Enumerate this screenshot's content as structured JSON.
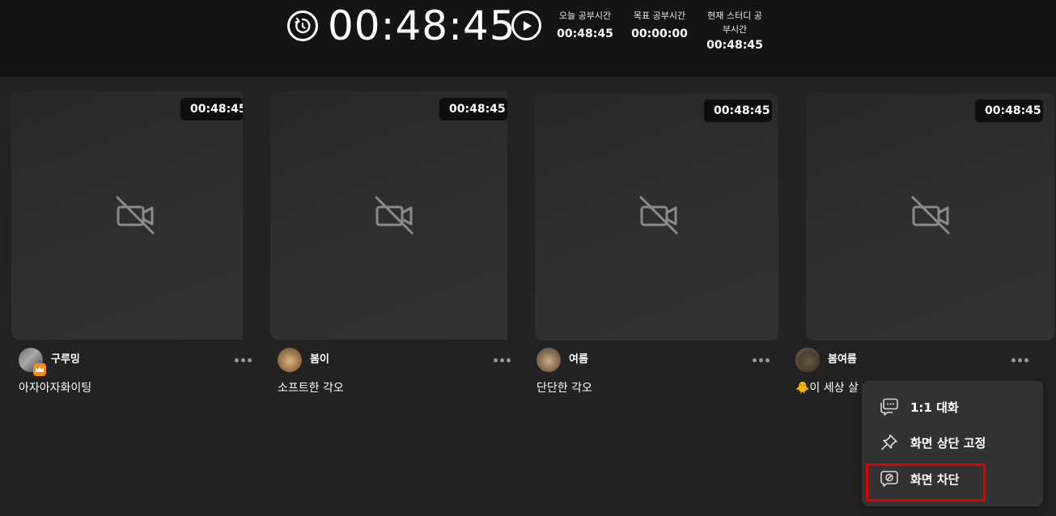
{
  "timer": {
    "elapsed": "00:48:45",
    "reset_icon": "reset-icon",
    "play_icon": "play-icon"
  },
  "stats": {
    "today_label": "오늘 공부시간",
    "today_value": "00:48:45",
    "goal_label": "목표 공부시간",
    "goal_value": "00:00:00",
    "current_label_line1": "현재 스터디 공",
    "current_label_line2": "부시간",
    "current_value": "00:48:45"
  },
  "participants": [
    {
      "name": "구루밍",
      "time": "00:48:45",
      "status": "아자아자화이팅",
      "is_host": true
    },
    {
      "name": "봄이",
      "time": "00:48:45",
      "status": "소프트한 각오",
      "is_host": false
    },
    {
      "name": "여름",
      "time": "00:48:45",
      "status": "단단한 각오",
      "is_host": false
    },
    {
      "name": "봄여름",
      "time": "00:48:45",
      "status": "🐥이 세상 살",
      "is_host": false
    }
  ],
  "context_menu": {
    "items": [
      {
        "label": "1:1 대화",
        "icon": "chat-icon"
      },
      {
        "label": "화면 상단 고정",
        "icon": "pin-icon"
      },
      {
        "label": "화면 차단",
        "icon": "block-screen-icon"
      }
    ],
    "highlight_color": "#e00000"
  },
  "colors": {
    "background": "#222222",
    "topbar": "#141414",
    "host_badge": "#f08a1a"
  }
}
